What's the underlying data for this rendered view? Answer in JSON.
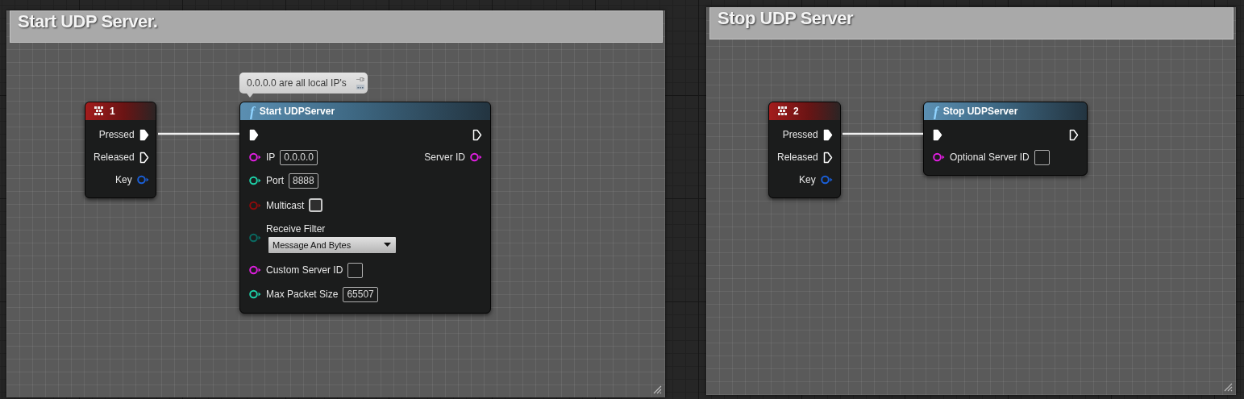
{
  "comments": [
    {
      "title": "Start UDP Server.",
      "nodes": [
        {
          "kind": "event",
          "title": "1",
          "outputs": [
            {
              "kind": "exec",
              "label": "Pressed",
              "connected": true
            },
            {
              "kind": "exec",
              "label": "Released",
              "connected": false
            },
            {
              "kind": "pin",
              "label": "Key",
              "color": "#1a5fd8",
              "connected": false
            }
          ]
        },
        {
          "kind": "function",
          "icon": "f",
          "title": "Start UDPServer",
          "bubble": "0.0.0.0 are all local IP's",
          "inputs": [
            {
              "kind": "exec",
              "connected": true
            },
            {
              "kind": "field",
              "label": "IP",
              "color": "#e01ee0",
              "connected": false,
              "value": "0.0.0.0"
            },
            {
              "kind": "field",
              "label": "Port",
              "color": "#1ed0a8",
              "connected": false,
              "value": "8888"
            },
            {
              "kind": "checkbox",
              "label": "Multicast",
              "color": "#8c0b0b",
              "connected": false,
              "checked": false
            },
            {
              "kind": "dropdown",
              "label": "Receive Filter",
              "color": "#0a6a62",
              "connected": false,
              "value": "Message And Bytes"
            },
            {
              "kind": "field",
              "label": "Custom Server ID",
              "color": "#e01ee0",
              "connected": false
            },
            {
              "kind": "field",
              "label": "Max Packet Size",
              "color": "#1ed0a8",
              "connected": false,
              "value": "65507"
            }
          ],
          "outputs": [
            {
              "kind": "exec",
              "connected": false
            },
            {
              "kind": "pin",
              "label": "Server ID",
              "color": "#e01ee0",
              "connected": false
            }
          ]
        }
      ]
    },
    {
      "title": "Stop UDP Server",
      "nodes": [
        {
          "kind": "event",
          "title": "2",
          "outputs": [
            {
              "kind": "exec",
              "label": "Pressed",
              "connected": true
            },
            {
              "kind": "exec",
              "label": "Released",
              "connected": false
            },
            {
              "kind": "pin",
              "label": "Key",
              "color": "#1a5fd8",
              "connected": false
            }
          ]
        },
        {
          "kind": "function",
          "icon": "f",
          "title": "Stop UDPServer",
          "inputs": [
            {
              "kind": "exec",
              "connected": true
            },
            {
              "kind": "field",
              "label": "Optional Server ID",
              "color": "#e01ee0",
              "connected": false
            }
          ],
          "outputs": [
            {
              "kind": "exec",
              "connected": false
            }
          ]
        }
      ]
    }
  ]
}
